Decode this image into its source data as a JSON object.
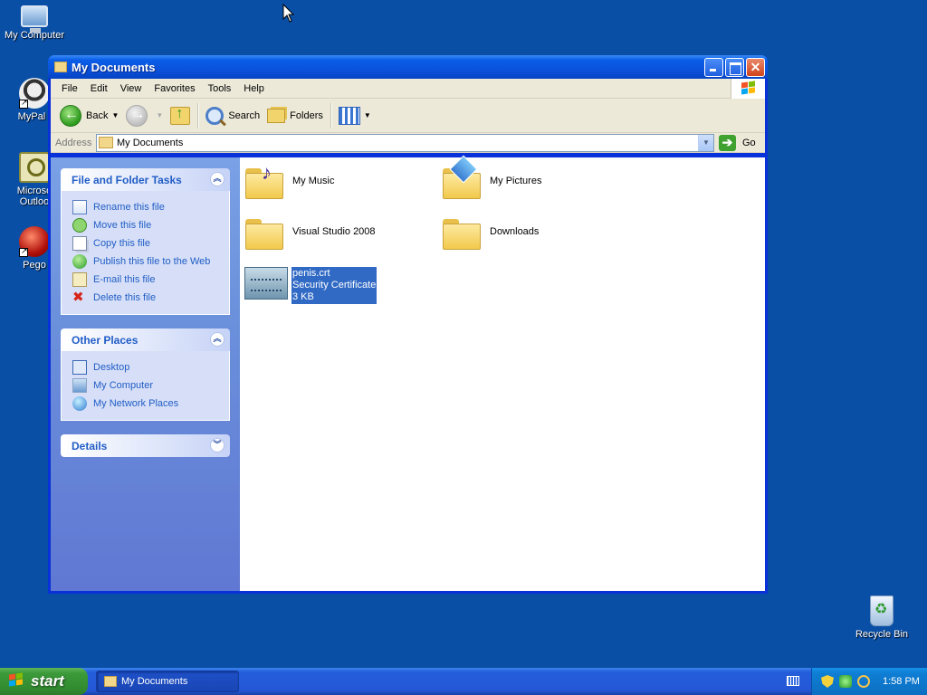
{
  "desktop": {
    "icons": [
      {
        "label": "My Computer",
        "icon": "computer-icon"
      },
      {
        "label": "MyPal t",
        "icon": "raccoon-icon"
      },
      {
        "label": "Microso Outloo",
        "icon": "outlook-icon"
      },
      {
        "label": "Pego",
        "icon": "pego-icon"
      },
      {
        "label": "Recycle Bin",
        "icon": "recycle-bin-icon"
      }
    ]
  },
  "window": {
    "title": "My Documents",
    "menu": [
      "File",
      "Edit",
      "View",
      "Favorites",
      "Tools",
      "Help"
    ],
    "toolbar": {
      "back_label": "Back",
      "search_label": "Search",
      "folders_label": "Folders"
    },
    "address": {
      "label": "Address",
      "value": "My Documents",
      "go_label": "Go"
    },
    "taskpane": {
      "file_tasks": {
        "title": "File and Folder Tasks",
        "items": [
          {
            "label": "Rename this file",
            "icon": "rename-icon"
          },
          {
            "label": "Move this file",
            "icon": "move-icon"
          },
          {
            "label": "Copy this file",
            "icon": "copy-icon"
          },
          {
            "label": "Publish this file to the Web",
            "icon": "publish-icon"
          },
          {
            "label": "E-mail this file",
            "icon": "email-icon"
          },
          {
            "label": "Delete this file",
            "icon": "delete-icon"
          }
        ]
      },
      "other_places": {
        "title": "Other Places",
        "items": [
          {
            "label": "Desktop",
            "icon": "desktop-icon"
          },
          {
            "label": "My Computer",
            "icon": "my-computer-icon"
          },
          {
            "label": "My Network Places",
            "icon": "network-places-icon"
          }
        ]
      },
      "details": {
        "title": "Details"
      }
    },
    "files": [
      {
        "name": "My Music",
        "type": "folder"
      },
      {
        "name": "My Pictures",
        "type": "folder"
      },
      {
        "name": "Visual Studio 2008",
        "type": "folder"
      },
      {
        "name": "Downloads",
        "type": "folder"
      },
      {
        "name": "penis.crt",
        "type": "Security Certificate",
        "size": "3 KB",
        "selected": true
      }
    ]
  },
  "taskbar": {
    "start_label": "start",
    "task_button": "My Documents",
    "clock": "1:58 PM"
  },
  "colors": {
    "desktop": "#0a4fa6",
    "titlebar": "#0a5ee8",
    "taskpane": "#6a8fdb",
    "link": "#215dc6",
    "selection": "#316ac5",
    "start": "#3c9a3a"
  }
}
